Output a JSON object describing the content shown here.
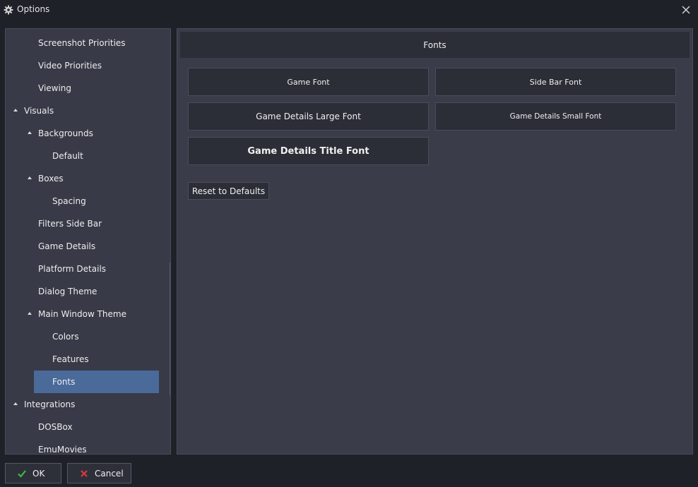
{
  "window": {
    "title": "Options",
    "title_icon": "gear-icon",
    "close_icon": "close-icon"
  },
  "tree": {
    "items": [
      {
        "label": "Screenshot Priorities",
        "level": 1,
        "expander": false,
        "selected": false
      },
      {
        "label": "Video Priorities",
        "level": 1,
        "expander": false,
        "selected": false
      },
      {
        "label": "Viewing",
        "level": 1,
        "expander": false,
        "selected": false
      },
      {
        "label": "Visuals",
        "level": 0,
        "expander": true,
        "selected": false
      },
      {
        "label": "Backgrounds",
        "level": 1,
        "expander": true,
        "selected": false
      },
      {
        "label": "Default",
        "level": 2,
        "expander": false,
        "selected": false
      },
      {
        "label": "Boxes",
        "level": 1,
        "expander": true,
        "selected": false
      },
      {
        "label": "Spacing",
        "level": 2,
        "expander": false,
        "selected": false
      },
      {
        "label": "Filters Side Bar",
        "level": 1,
        "expander": false,
        "selected": false
      },
      {
        "label": "Game Details",
        "level": 1,
        "expander": false,
        "selected": false
      },
      {
        "label": "Platform Details",
        "level": 1,
        "expander": false,
        "selected": false
      },
      {
        "label": "Dialog Theme",
        "level": 1,
        "expander": false,
        "selected": false
      },
      {
        "label": "Main Window Theme",
        "level": 1,
        "expander": true,
        "selected": false
      },
      {
        "label": "Colors",
        "level": 2,
        "expander": false,
        "selected": false
      },
      {
        "label": "Features",
        "level": 2,
        "expander": false,
        "selected": false
      },
      {
        "label": "Fonts",
        "level": 2,
        "expander": false,
        "selected": true
      },
      {
        "label": "Integrations",
        "level": 0,
        "expander": true,
        "selected": false
      },
      {
        "label": "DOSBox",
        "level": 1,
        "expander": false,
        "selected": false
      },
      {
        "label": "EmuMovies",
        "level": 1,
        "expander": false,
        "selected": false
      }
    ]
  },
  "content": {
    "header": "Fonts",
    "buttons": {
      "game_font": "Game Font",
      "side_bar_font": "Side Bar Font",
      "game_details_large_font": "Game Details Large Font",
      "game_details_small_font": "Game Details Small Font",
      "game_details_title_font": "Game Details Title Font"
    },
    "reset": "Reset to Defaults"
  },
  "footer": {
    "ok": {
      "label": "OK",
      "icon": "checkmark-icon",
      "icon_color": "#3cc24a"
    },
    "cancel": {
      "label": "Cancel",
      "icon": "cancel-icon",
      "icon_color": "#d83a3a"
    }
  }
}
